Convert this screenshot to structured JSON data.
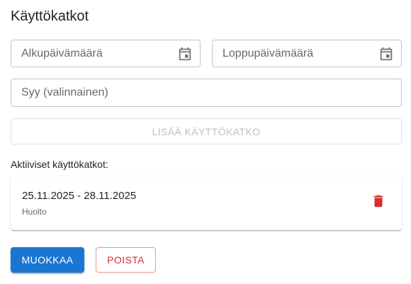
{
  "title": "Käyttökatkot",
  "form": {
    "start_placeholder": "Alkupäivämäärä",
    "start_icon": "calendar-icon",
    "end_placeholder": "Loppupäivämäärä",
    "end_icon": "calendar-icon",
    "reason_placeholder": "Syy (valinnainen)",
    "add_label": "LISÄÄ KÄYTTÖKATKO"
  },
  "active_label": "Aktiiviset käyttökatkot:",
  "outages": [
    {
      "dates": "25.11.2025 - 28.11.2025",
      "reason": "Huolto",
      "delete_icon": "trash-icon"
    }
  ],
  "actions": {
    "edit_label": "MUOKKAA",
    "delete_label": "POISTA"
  },
  "colors": {
    "primary": "#1976d2",
    "error": "#d32f2f"
  }
}
